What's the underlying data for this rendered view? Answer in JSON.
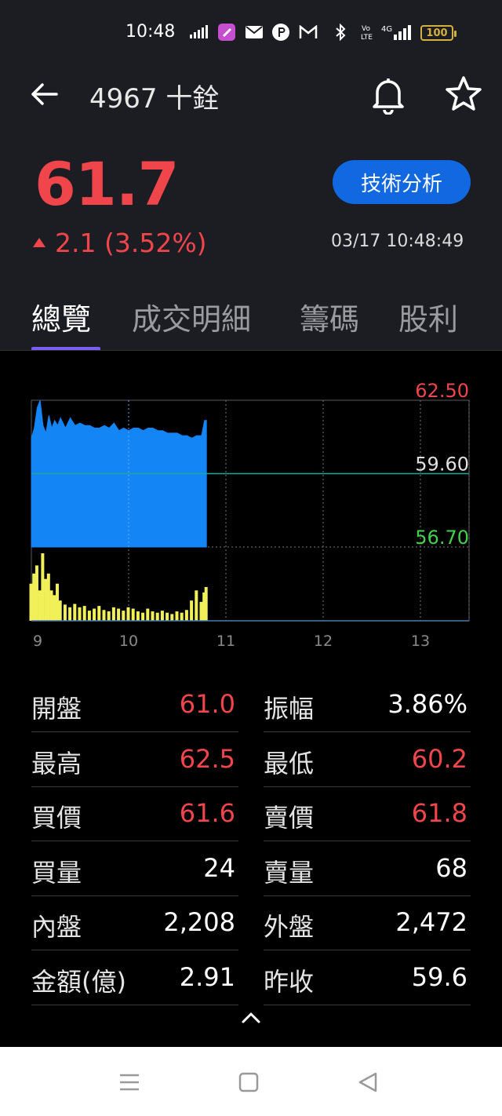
{
  "status_bar": {
    "time": "10:48",
    "icons": [
      "signal-speed-icon",
      "app-icon",
      "mail-icon",
      "p-icon",
      "gmail-icon",
      "bluetooth-icon",
      "volte-icon",
      "4g-signal-icon"
    ],
    "battery": "100"
  },
  "header": {
    "title": "4967 十銓"
  },
  "quote": {
    "price": "61.7",
    "change": "2.1 (3.52%)",
    "datetime": "03/17 10:48:49",
    "ta_button": "技術分析"
  },
  "tabs": [
    "總覽",
    "成交明細",
    "籌碼",
    "股利"
  ],
  "colors": {
    "up": "#f0464b",
    "down": "#44d04a",
    "accent": "#1168e0",
    "tab_indicator": "#7b5cf0",
    "area": "#1485f5",
    "volume": "#f2f058"
  },
  "chart_data": {
    "type": "area",
    "price_labels": {
      "high": "62.50",
      "ref": "59.60",
      "low": "56.70"
    },
    "ylim": [
      56.7,
      62.5
    ],
    "ref_price": 59.6,
    "x_ticks": [
      "9",
      "10",
      "11",
      "12",
      "13"
    ],
    "x_range": [
      9,
      13.5
    ],
    "x": [
      9.0,
      9.03,
      9.06,
      9.09,
      9.12,
      9.15,
      9.18,
      9.21,
      9.24,
      9.27,
      9.3,
      9.35,
      9.4,
      9.45,
      9.5,
      9.55,
      9.6,
      9.65,
      9.7,
      9.75,
      9.8,
      9.85,
      9.9,
      9.95,
      10.0,
      10.05,
      10.1,
      10.15,
      10.2,
      10.25,
      10.3,
      10.35,
      10.4,
      10.45,
      10.5,
      10.55,
      10.6,
      10.65,
      10.7,
      10.75,
      10.78,
      10.8
    ],
    "price": [
      61.0,
      61.4,
      62.2,
      62.5,
      61.5,
      61.2,
      61.9,
      61.4,
      61.7,
      61.5,
      61.8,
      61.4,
      61.8,
      61.5,
      61.6,
      61.5,
      61.5,
      61.4,
      61.4,
      61.5,
      61.4,
      61.6,
      61.3,
      61.4,
      61.3,
      61.4,
      61.4,
      61.3,
      61.4,
      61.4,
      61.3,
      61.3,
      61.2,
      61.2,
      61.2,
      61.1,
      61.1,
      61.0,
      61.1,
      61.1,
      61.7,
      61.7
    ],
    "volume": [
      55,
      70,
      82,
      45,
      100,
      62,
      70,
      45,
      38,
      55,
      30,
      24,
      20,
      25,
      20,
      22,
      15,
      18,
      22,
      16,
      14,
      20,
      18,
      15,
      20,
      18,
      14,
      12,
      18,
      14,
      12,
      15,
      12,
      10,
      14,
      12,
      16,
      30,
      45,
      28,
      42,
      50
    ]
  },
  "stats": [
    {
      "label": "開盤",
      "value": "61.0",
      "red": true
    },
    {
      "label": "振幅",
      "value": "3.86%",
      "red": false
    },
    {
      "label": "最高",
      "value": "62.5",
      "red": true
    },
    {
      "label": "最低",
      "value": "60.2",
      "red": true
    },
    {
      "label": "買價",
      "value": "61.6",
      "red": true
    },
    {
      "label": "賣價",
      "value": "61.8",
      "red": true
    },
    {
      "label": "買量",
      "value": "24",
      "red": false
    },
    {
      "label": "賣量",
      "value": "68",
      "red": false
    },
    {
      "label": "內盤",
      "value": "2,208",
      "red": false
    },
    {
      "label": "外盤",
      "value": "2,472",
      "red": false
    },
    {
      "label": "金額(億)",
      "value": "2.91",
      "red": false
    },
    {
      "label": "昨收",
      "value": "59.6",
      "red": false
    }
  ]
}
